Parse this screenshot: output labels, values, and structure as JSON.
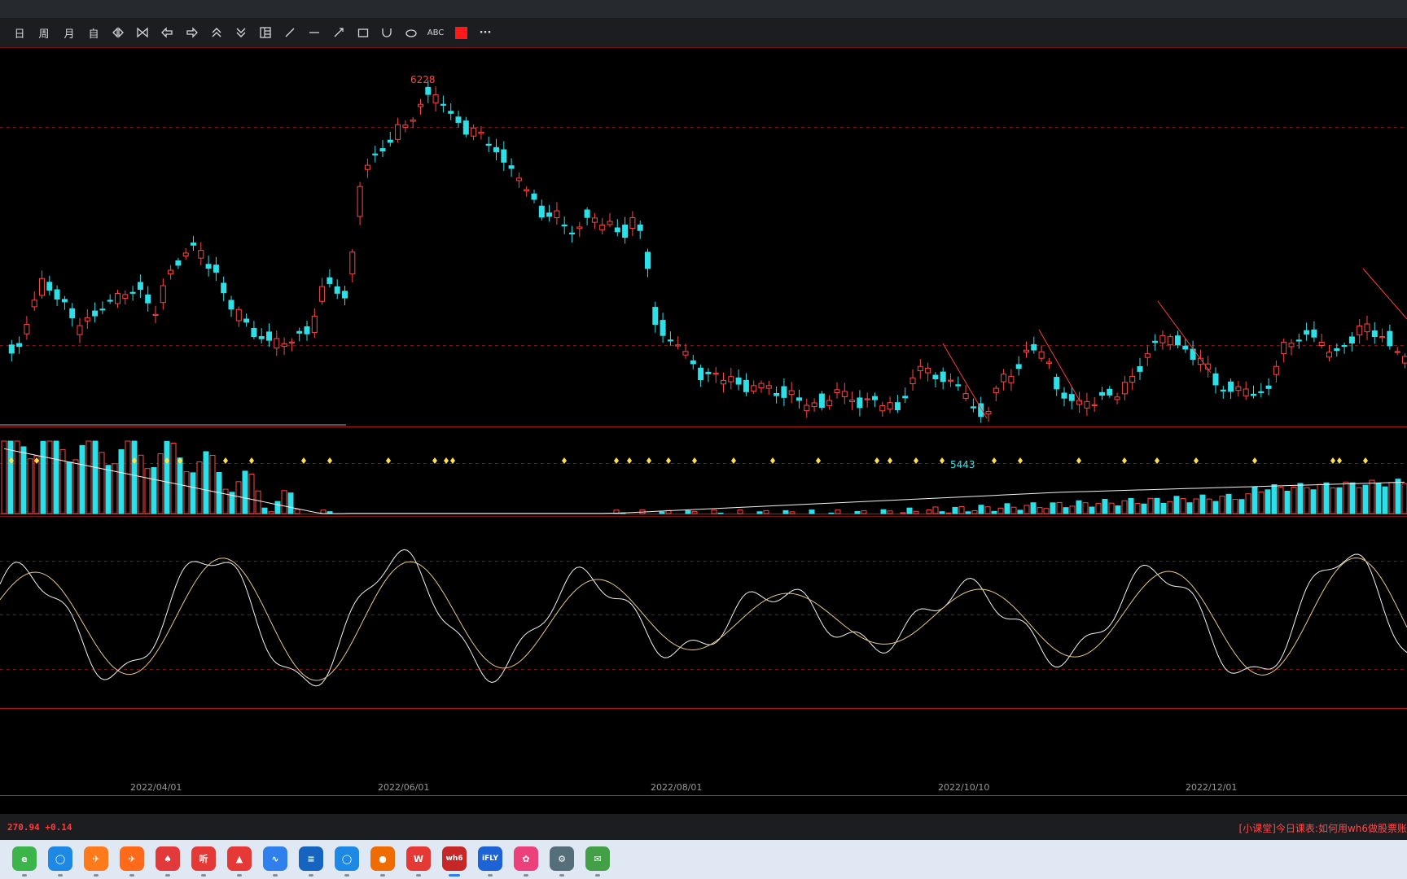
{
  "toolbar": {
    "items": [
      {
        "label": "日",
        "icon": ""
      },
      {
        "label": "周",
        "icon": ""
      },
      {
        "label": "月",
        "icon": ""
      },
      {
        "label": "自",
        "icon": ""
      },
      {
        "label": "",
        "icon": "zoom-out-icon"
      },
      {
        "label": "",
        "icon": "zoom-in-icon"
      },
      {
        "label": "",
        "icon": "arrow-left-icon"
      },
      {
        "label": "",
        "icon": "arrow-right-icon"
      },
      {
        "label": "",
        "icon": "double-up-icon"
      },
      {
        "label": "",
        "icon": "double-down-icon"
      },
      {
        "label": "",
        "icon": "layout-icon"
      },
      {
        "label": "",
        "icon": "diagonal-line-icon"
      },
      {
        "label": "",
        "icon": "horizontal-line-icon"
      },
      {
        "label": "",
        "icon": "arrow-line-icon"
      },
      {
        "label": "",
        "icon": "rectangle-icon"
      },
      {
        "label": "",
        "icon": "arc-icon"
      },
      {
        "label": "",
        "icon": "ellipse-icon"
      },
      {
        "label": "ABC",
        "icon": "text-icon"
      },
      {
        "label": "",
        "icon": "color-swatch-icon"
      },
      {
        "label": "···",
        "icon": "more-icon"
      }
    ],
    "swatch_color": "#ff1a1a"
  },
  "chart_data": {
    "type": "candlestick",
    "panels": [
      "price",
      "volume",
      "oscillator"
    ],
    "price_high_label": "6228",
    "price_low_label": "5443",
    "xaxis_labels": [
      "2022/04/01",
      "2022/06/01",
      "2022/08/01",
      "2022/10/10",
      "2022/12/01"
    ],
    "colors": {
      "up": "#ff4545",
      "down": "#2de0e8",
      "line": "#f2f2f2",
      "line2": "#e8c88a",
      "grid": "#7a1414"
    }
  },
  "status": {
    "left_text": "270.94 +0.14",
    "right_text": "[小课堂]今日课表:如何用wh6做股票账"
  },
  "taskbar": {
    "apps": [
      {
        "name": "360-browser-icon",
        "color": "#3bb54a",
        "glyph": "e"
      },
      {
        "name": "browser-icon",
        "color": "#1e88e5",
        "glyph": "◯"
      },
      {
        "name": "feishu-icon",
        "color": "#ff7a1a",
        "glyph": "✈"
      },
      {
        "name": "feishu-2-icon",
        "color": "#ff6a1a",
        "glyph": "✈"
      },
      {
        "name": "cards-icon",
        "color": "#e23a3a",
        "glyph": "♠"
      },
      {
        "name": "listen-icon",
        "color": "#e53935",
        "glyph": "听"
      },
      {
        "name": "stock-icon",
        "color": "#e53935",
        "glyph": "▲"
      },
      {
        "name": "chart-app-icon",
        "color": "#2f80ed",
        "glyph": "∿"
      },
      {
        "name": "notepad-icon",
        "color": "#1565c0",
        "glyph": "≡"
      },
      {
        "name": "browser-2-icon",
        "color": "#1e88e5",
        "glyph": "◯"
      },
      {
        "name": "game-icon",
        "color": "#ef6c00",
        "glyph": "●"
      },
      {
        "name": "wps-icon",
        "color": "#e53935",
        "glyph": "W"
      },
      {
        "name": "wh6-icon",
        "color": "#c62828",
        "glyph": "wh6"
      },
      {
        "name": "ifly-icon",
        "color": "#1e63d6",
        "glyph": "iFLY"
      },
      {
        "name": "photo-icon",
        "color": "#ec407a",
        "glyph": "✿"
      },
      {
        "name": "settings-icon",
        "color": "#546e7a",
        "glyph": "⚙"
      },
      {
        "name": "wechat-icon",
        "color": "#43a047",
        "glyph": "✉"
      }
    ]
  }
}
